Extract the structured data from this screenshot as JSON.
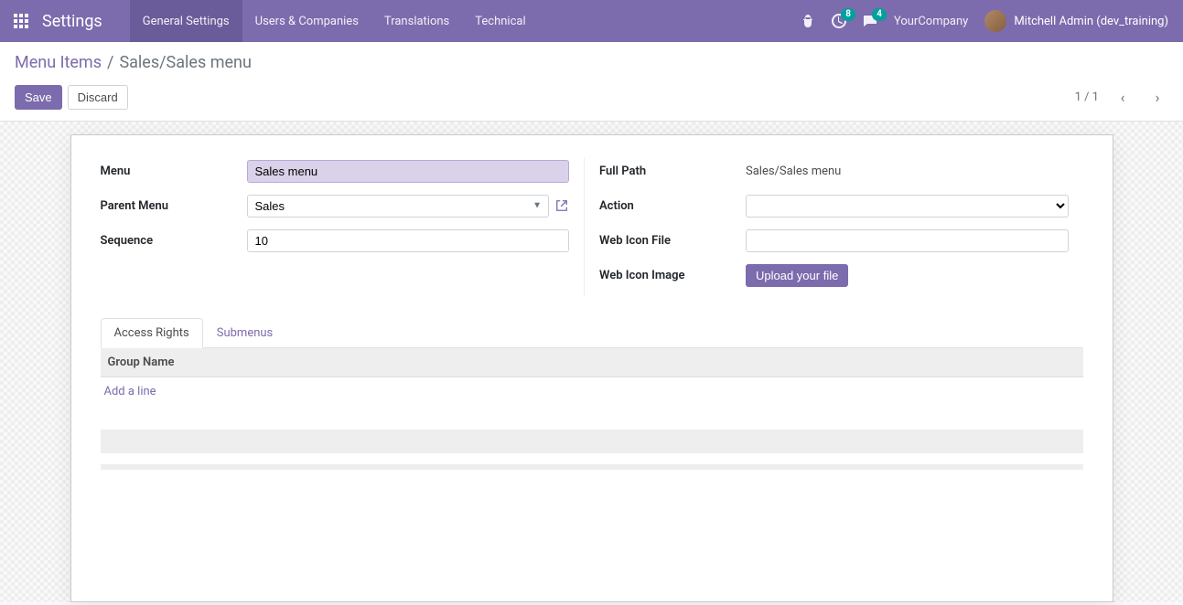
{
  "navbar": {
    "app_title": "Settings",
    "tabs": [
      "General Settings",
      "Users & Companies",
      "Translations",
      "Technical"
    ],
    "activity_badge": "8",
    "messages_badge": "4",
    "company": "YourCompany",
    "user": "Mitchell Admin (dev_training)"
  },
  "breadcrumbs": {
    "root": "Menu Items",
    "current": "Sales/Sales menu"
  },
  "actions": {
    "save": "Save",
    "discard": "Discard",
    "pager": "1 / 1"
  },
  "form": {
    "left": {
      "menu_label": "Menu",
      "menu_value": "Sales menu",
      "parent_label": "Parent Menu",
      "parent_value": "Sales",
      "sequence_label": "Sequence",
      "sequence_value": "10"
    },
    "right": {
      "fullpath_label": "Full Path",
      "fullpath_value": "Sales/Sales menu",
      "action_label": "Action",
      "action_value": "",
      "webicon_label": "Web Icon File",
      "webicon_value": "",
      "webiconimg_label": "Web Icon Image",
      "upload_label": "Upload your file"
    }
  },
  "tabs": {
    "access_rights": "Access Rights",
    "submenus": "Submenus"
  },
  "table": {
    "header": "Group Name",
    "add_line": "Add a line"
  }
}
